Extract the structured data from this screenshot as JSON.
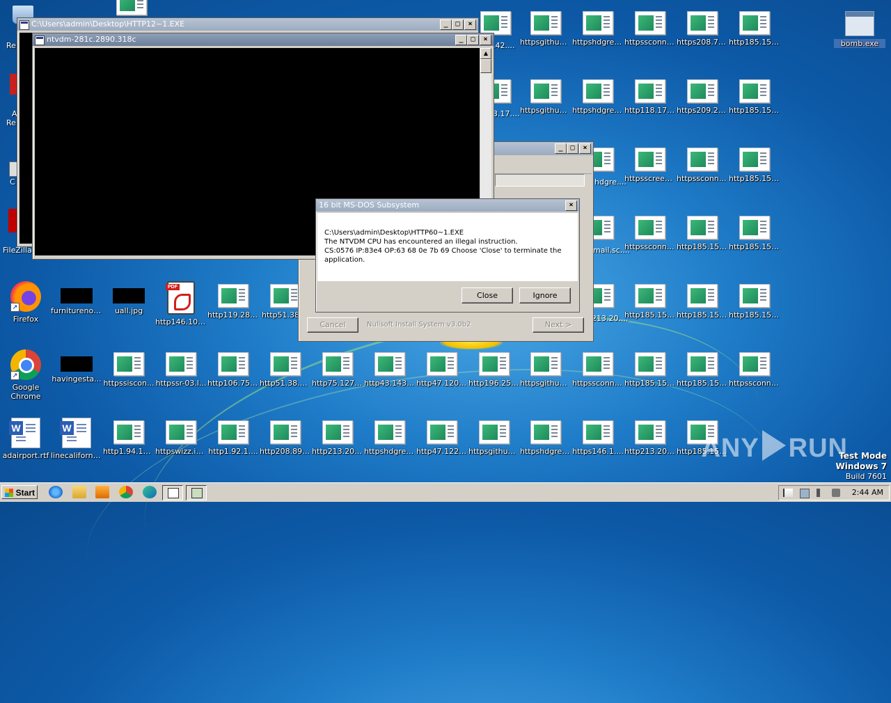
{
  "desktop": {
    "icons": [
      {
        "label": "bomb.exe",
        "type": "exe",
        "selected": true
      },
      {
        "label": "httpsgithub....",
        "type": "doc"
      },
      {
        "label": "httpshdgree....",
        "type": "doc"
      },
      {
        "label": "httpssconne....",
        "type": "doc"
      },
      {
        "label": "https208.71....",
        "type": "doc"
      },
      {
        "label": "http185.15....",
        "type": "doc"
      },
      {
        "label": "httpsgithub....",
        "type": "doc"
      },
      {
        "label": "httpshdgree....",
        "type": "doc"
      },
      {
        "label": "http118.17....",
        "type": "doc"
      },
      {
        "label": "https209.24....",
        "type": "doc"
      },
      {
        "label": "http185.15....",
        "type": "doc"
      },
      {
        "label": "httpsscreen....",
        "type": "doc"
      },
      {
        "label": "httpssconne....",
        "type": "doc"
      },
      {
        "label": "http185.15....",
        "type": "doc"
      },
      {
        "label": "httpssconne....",
        "type": "doc"
      },
      {
        "label": "http185.15....",
        "type": "doc"
      },
      {
        "label": "http185.15....",
        "type": "doc"
      },
      {
        "label": "http185.15....",
        "type": "doc"
      },
      {
        "label": "http185.15....",
        "type": "doc"
      },
      {
        "label": "http185.15....",
        "type": "doc"
      },
      {
        "label": "Firefox",
        "type": "firefox"
      },
      {
        "label": "furniturenok...",
        "type": "black"
      },
      {
        "label": "uall.jpg",
        "type": "black"
      },
      {
        "label": "http146.10....",
        "type": "pdf"
      },
      {
        "label": "http119.28....",
        "type": "doc"
      },
      {
        "label": "http51.38....",
        "type": "doc"
      },
      {
        "label": "Google Chrome",
        "type": "chrome"
      },
      {
        "label": "havingesta...",
        "type": "black"
      },
      {
        "label": "httpssiscon...",
        "type": "doc"
      },
      {
        "label": "httpssr-03.l...",
        "type": "doc"
      },
      {
        "label": "http106.75....",
        "type": "doc"
      },
      {
        "label": "http51.38.1...",
        "type": "doc"
      },
      {
        "label": "http75.127....",
        "type": "doc"
      },
      {
        "label": "http43.143....",
        "type": "doc"
      },
      {
        "label": "http47.120....",
        "type": "doc"
      },
      {
        "label": "http196.25....",
        "type": "doc"
      },
      {
        "label": "httpsgithub....",
        "type": "doc"
      },
      {
        "label": "httpssconne....",
        "type": "doc"
      },
      {
        "label": "http185.15....",
        "type": "doc"
      },
      {
        "label": "http185.15....",
        "type": "doc"
      },
      {
        "label": "httpssconne...",
        "type": "doc"
      },
      {
        "label": "adairport.rtf",
        "type": "word"
      },
      {
        "label": "linecalifornia...",
        "type": "word"
      },
      {
        "label": "http1.94.16....",
        "type": "doc"
      },
      {
        "label": "httpswizz.in....",
        "type": "doc"
      },
      {
        "label": "http1.92.1....",
        "type": "doc"
      },
      {
        "label": "http208.89....",
        "type": "doc"
      },
      {
        "label": "http213.20....",
        "type": "doc"
      },
      {
        "label": "httpshdgre....",
        "type": "doc"
      },
      {
        "label": "http47.122....",
        "type": "doc"
      },
      {
        "label": "httpsgithub....",
        "type": "doc"
      },
      {
        "label": "httpshdgree....",
        "type": "doc"
      },
      {
        "label": "https146.1....",
        "type": "doc"
      },
      {
        "label": "http213.20....",
        "type": "doc"
      },
      {
        "label": "http185.15....",
        "type": "doc"
      }
    ],
    "partial_labels": {
      "row1_left": "Re",
      "row2_left_a": "A",
      "row2_left_b": "Re",
      "row3_left": "C",
      "filezilla": "FileZilla C",
      "partial_42": ".42....",
      "partial_17": "3.17....",
      "partial_hdgre": "hdgre....",
      "partial_mail": "mail.sc....",
      "partial_213": "213.20...."
    }
  },
  "windows": {
    "outer_console_title": "C:\\Users\\admin\\Desktop\\HTTP12~1.EXE",
    "inner_console_title": "ntvdm-281c.2890.318c",
    "nsis": {
      "cancel_label": "Cancel",
      "brand": "Nullsoft Install System v3.0b2",
      "next_label": "Next >"
    },
    "dialog": {
      "title": "16 bit MS-DOS Subsystem",
      "message": "C:\\Users\\admin\\Desktop\\HTTP60~1.EXE\nThe NTVDM CPU has encountered an illegal instruction.\nCS:0576 IP:83e4 OP:63 68 0e 7b 69 Choose 'Close' to terminate the application.",
      "close_label": "Close",
      "ignore_label": "Ignore"
    }
  },
  "taskbar": {
    "start_label": "Start",
    "clock": "2:44 AM"
  },
  "overlay": {
    "watermark_left": "ANY",
    "watermark_right": "RUN",
    "test_mode_line1": "Test Mode",
    "test_mode_line2": "Windows 7",
    "test_mode_line3": "Build 7601"
  },
  "colors": {
    "accent": "#1f7cc8",
    "titlebar": "#6d8099"
  }
}
